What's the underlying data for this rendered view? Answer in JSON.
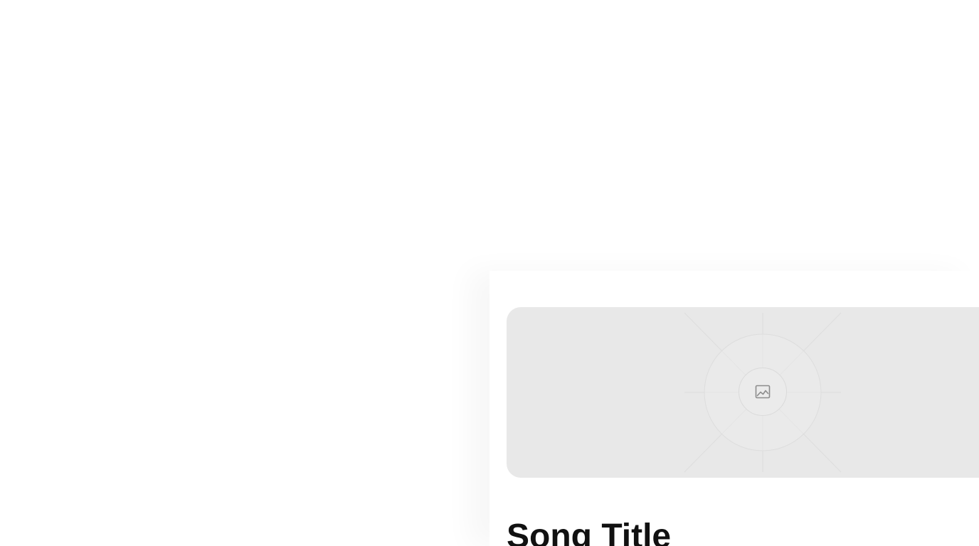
{
  "song": {
    "title": "Song Title"
  },
  "artwork": {
    "icon": "image-placeholder-icon"
  },
  "colors": {
    "background": "#ffffff",
    "artwork_background": "#e8e8e8",
    "placeholder_line": "#d8d8d8",
    "icon": "#8c8c8c",
    "title_text": "#111111"
  }
}
